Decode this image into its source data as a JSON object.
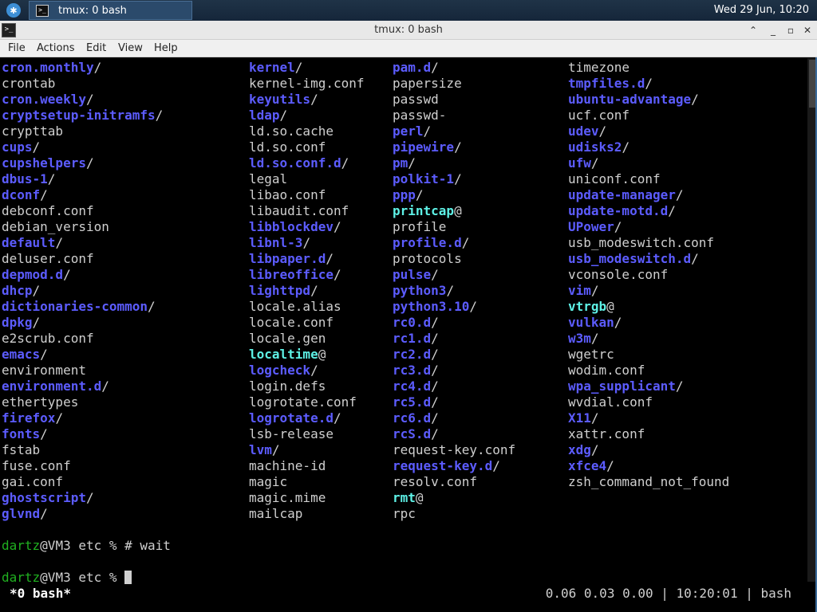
{
  "panel": {
    "task_label": "tmux: 0 bash",
    "clock": "Wed 29 Jun, 10:20"
  },
  "window": {
    "title": "tmux: 0 bash",
    "menus": [
      "File",
      "Actions",
      "Edit",
      "View",
      "Help"
    ]
  },
  "listing": {
    "columns": [
      [
        {
          "name": "cron.monthly",
          "type": "dir"
        },
        {
          "name": "crontab",
          "type": "file"
        },
        {
          "name": "cron.weekly",
          "type": "dir"
        },
        {
          "name": "cryptsetup-initramfs",
          "type": "dir"
        },
        {
          "name": "crypttab",
          "type": "file"
        },
        {
          "name": "cups",
          "type": "dir"
        },
        {
          "name": "cupshelpers",
          "type": "dir"
        },
        {
          "name": "dbus-1",
          "type": "dir"
        },
        {
          "name": "dconf",
          "type": "dir"
        },
        {
          "name": "debconf.conf",
          "type": "file"
        },
        {
          "name": "debian_version",
          "type": "file"
        },
        {
          "name": "default",
          "type": "dir"
        },
        {
          "name": "deluser.conf",
          "type": "file"
        },
        {
          "name": "depmod.d",
          "type": "dir"
        },
        {
          "name": "dhcp",
          "type": "dir"
        },
        {
          "name": "dictionaries-common",
          "type": "dir"
        },
        {
          "name": "dpkg",
          "type": "dir"
        },
        {
          "name": "e2scrub.conf",
          "type": "file"
        },
        {
          "name": "emacs",
          "type": "dir"
        },
        {
          "name": "environment",
          "type": "file"
        },
        {
          "name": "environment.d",
          "type": "dir"
        },
        {
          "name": "ethertypes",
          "type": "file"
        },
        {
          "name": "firefox",
          "type": "dir"
        },
        {
          "name": "fonts",
          "type": "dir"
        },
        {
          "name": "fstab",
          "type": "file"
        },
        {
          "name": "fuse.conf",
          "type": "file"
        },
        {
          "name": "gai.conf",
          "type": "file"
        },
        {
          "name": "ghostscript",
          "type": "dir"
        },
        {
          "name": "glvnd",
          "type": "dir"
        }
      ],
      [
        {
          "name": "kernel",
          "type": "dir"
        },
        {
          "name": "kernel-img.conf",
          "type": "file"
        },
        {
          "name": "keyutils",
          "type": "dir"
        },
        {
          "name": "ldap",
          "type": "dir"
        },
        {
          "name": "ld.so.cache",
          "type": "file"
        },
        {
          "name": "ld.so.conf",
          "type": "file"
        },
        {
          "name": "ld.so.conf.d",
          "type": "dir"
        },
        {
          "name": "legal",
          "type": "file"
        },
        {
          "name": "libao.conf",
          "type": "file"
        },
        {
          "name": "libaudit.conf",
          "type": "file"
        },
        {
          "name": "libblockdev",
          "type": "dir"
        },
        {
          "name": "libnl-3",
          "type": "dir"
        },
        {
          "name": "libpaper.d",
          "type": "dir"
        },
        {
          "name": "libreoffice",
          "type": "dir"
        },
        {
          "name": "lighttpd",
          "type": "dir"
        },
        {
          "name": "locale.alias",
          "type": "file"
        },
        {
          "name": "locale.conf",
          "type": "file"
        },
        {
          "name": "locale.gen",
          "type": "file"
        },
        {
          "name": "localtime",
          "type": "link"
        },
        {
          "name": "logcheck",
          "type": "dir"
        },
        {
          "name": "login.defs",
          "type": "file"
        },
        {
          "name": "logrotate.conf",
          "type": "file"
        },
        {
          "name": "logrotate.d",
          "type": "dir"
        },
        {
          "name": "lsb-release",
          "type": "file"
        },
        {
          "name": "lvm",
          "type": "dir"
        },
        {
          "name": "machine-id",
          "type": "file"
        },
        {
          "name": "magic",
          "type": "file"
        },
        {
          "name": "magic.mime",
          "type": "file"
        },
        {
          "name": "mailcap",
          "type": "file"
        }
      ],
      [
        {
          "name": "pam.d",
          "type": "dir"
        },
        {
          "name": "papersize",
          "type": "file"
        },
        {
          "name": "passwd",
          "type": "file"
        },
        {
          "name": "passwd-",
          "type": "file"
        },
        {
          "name": "perl",
          "type": "dir"
        },
        {
          "name": "pipewire",
          "type": "dir"
        },
        {
          "name": "pm",
          "type": "dir"
        },
        {
          "name": "polkit-1",
          "type": "dir"
        },
        {
          "name": "ppp",
          "type": "dir"
        },
        {
          "name": "printcap",
          "type": "link"
        },
        {
          "name": "profile",
          "type": "file"
        },
        {
          "name": "profile.d",
          "type": "dir"
        },
        {
          "name": "protocols",
          "type": "file"
        },
        {
          "name": "pulse",
          "type": "dir"
        },
        {
          "name": "python3",
          "type": "dir"
        },
        {
          "name": "python3.10",
          "type": "dir"
        },
        {
          "name": "rc0.d",
          "type": "dir"
        },
        {
          "name": "rc1.d",
          "type": "dir"
        },
        {
          "name": "rc2.d",
          "type": "dir"
        },
        {
          "name": "rc3.d",
          "type": "dir"
        },
        {
          "name": "rc4.d",
          "type": "dir"
        },
        {
          "name": "rc5.d",
          "type": "dir"
        },
        {
          "name": "rc6.d",
          "type": "dir"
        },
        {
          "name": "rcS.d",
          "type": "dir"
        },
        {
          "name": "request-key.conf",
          "type": "file"
        },
        {
          "name": "request-key.d",
          "type": "dir"
        },
        {
          "name": "resolv.conf",
          "type": "file"
        },
        {
          "name": "rmt",
          "type": "link"
        },
        {
          "name": "rpc",
          "type": "file"
        }
      ],
      [
        {
          "name": "timezone",
          "type": "file"
        },
        {
          "name": "tmpfiles.d",
          "type": "dir"
        },
        {
          "name": "ubuntu-advantage",
          "type": "dir"
        },
        {
          "name": "ucf.conf",
          "type": "file"
        },
        {
          "name": "udev",
          "type": "dir"
        },
        {
          "name": "udisks2",
          "type": "dir"
        },
        {
          "name": "ufw",
          "type": "dir"
        },
        {
          "name": "uniconf.conf",
          "type": "file"
        },
        {
          "name": "update-manager",
          "type": "dir"
        },
        {
          "name": "update-motd.d",
          "type": "dir"
        },
        {
          "name": "UPower",
          "type": "dir"
        },
        {
          "name": "usb_modeswitch.conf",
          "type": "file"
        },
        {
          "name": "usb_modeswitch.d",
          "type": "dir"
        },
        {
          "name": "vconsole.conf",
          "type": "file"
        },
        {
          "name": "vim",
          "type": "dir"
        },
        {
          "name": "vtrgb",
          "type": "link"
        },
        {
          "name": "vulkan",
          "type": "dir"
        },
        {
          "name": "w3m",
          "type": "dir"
        },
        {
          "name": "wgetrc",
          "type": "file"
        },
        {
          "name": "wodim.conf",
          "type": "file"
        },
        {
          "name": "wpa_supplicant",
          "type": "dir"
        },
        {
          "name": "wvdial.conf",
          "type": "file"
        },
        {
          "name": "X11",
          "type": "dir"
        },
        {
          "name": "xattr.conf",
          "type": "file"
        },
        {
          "name": "xdg",
          "type": "dir"
        },
        {
          "name": "xfce4",
          "type": "dir"
        },
        {
          "name": "zsh_command_not_found",
          "type": "file"
        }
      ]
    ]
  },
  "shell": {
    "user": "dartz",
    "host_path": "@VM3 etc % ",
    "command1": "# wait",
    "command2": ""
  },
  "status": {
    "left": "*0 bash*",
    "right": "0.06 0.03 0.00 | 10:20:01 | bash"
  },
  "colors": {
    "dir": "#5c5cff",
    "link": "#5ef1e6",
    "file": "#cfcfcf",
    "user": "#20b020"
  }
}
